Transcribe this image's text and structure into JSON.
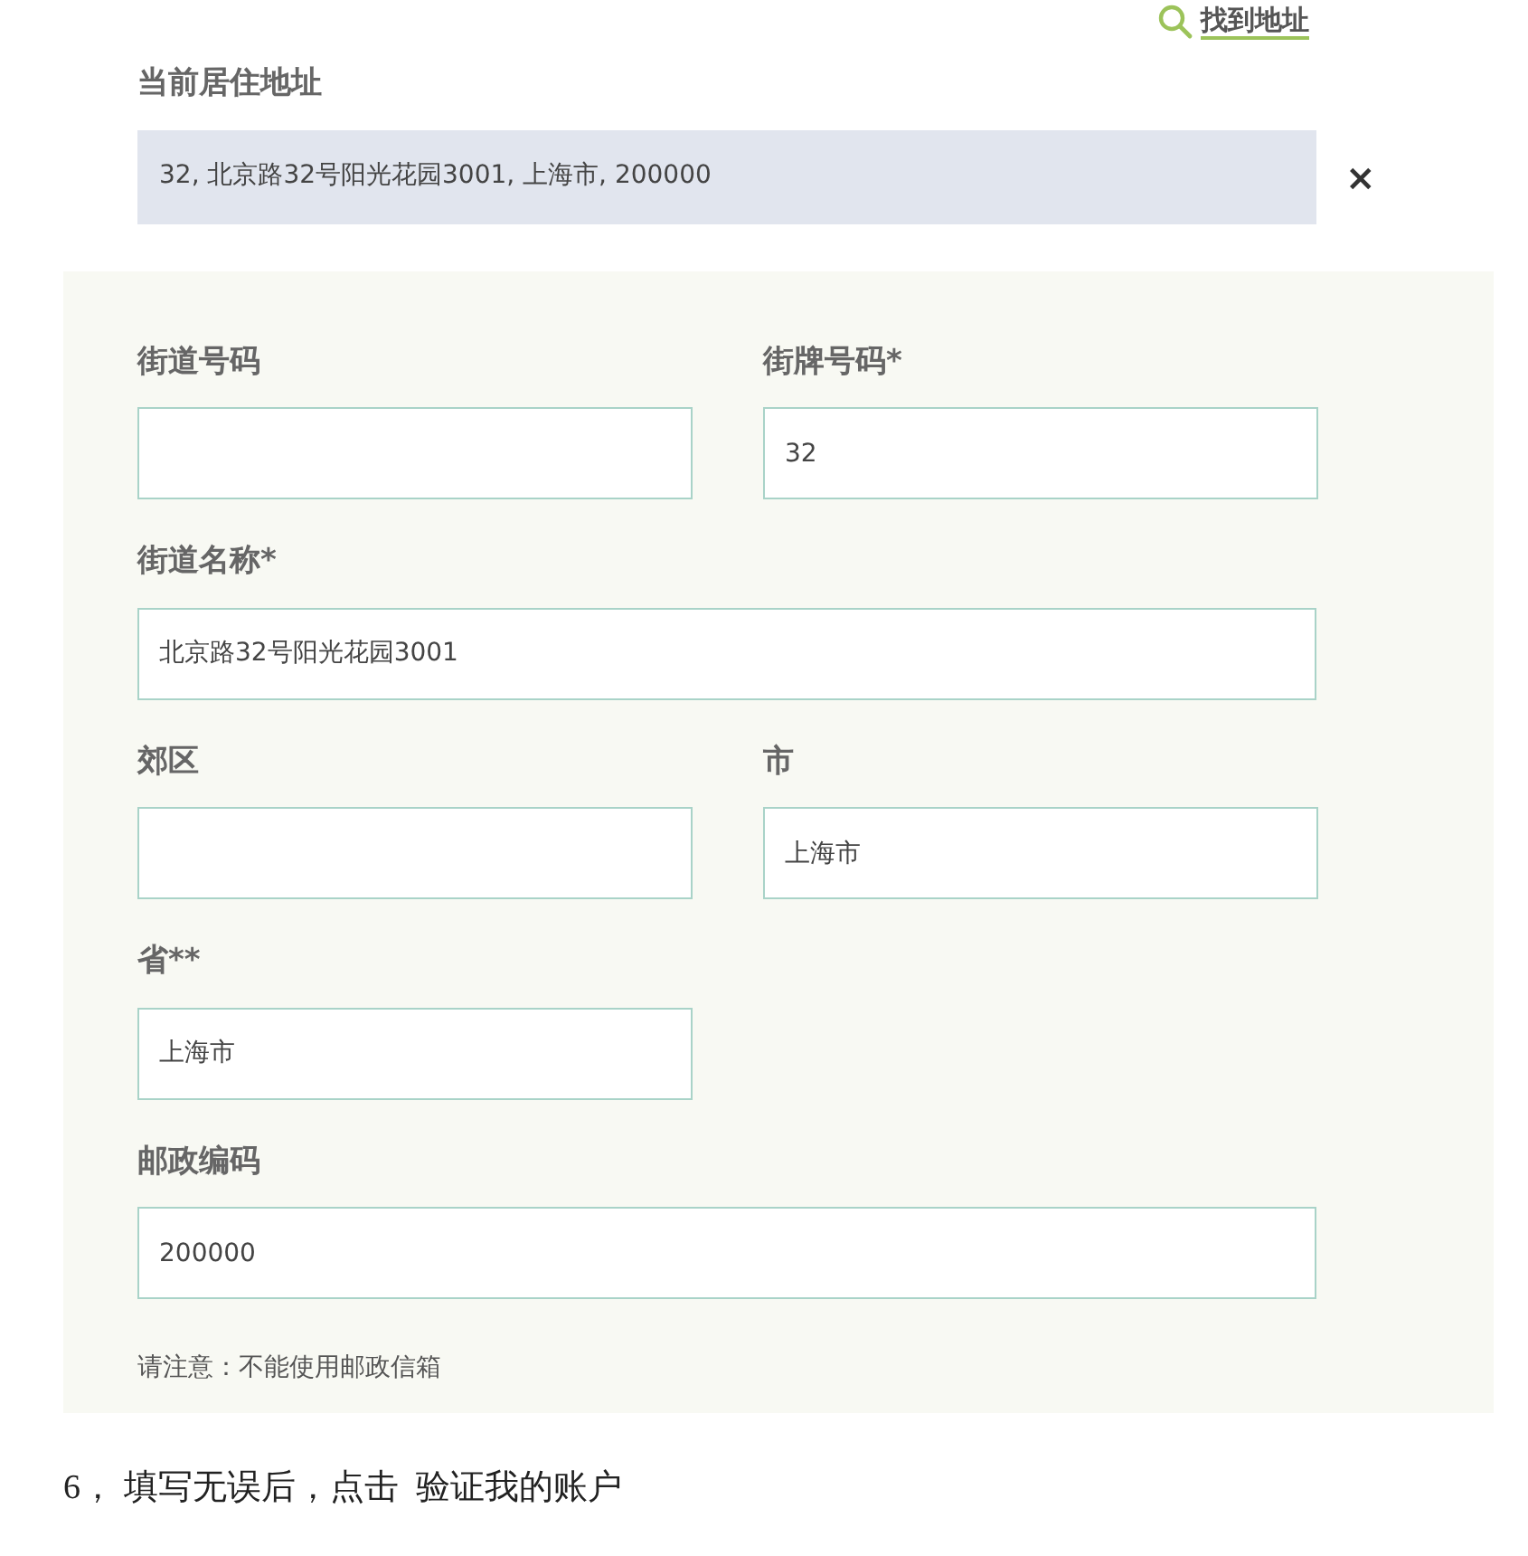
{
  "find_link": "找到地址",
  "current_address": {
    "label": "当前居住地址",
    "value": "32, 北京路32号阳光花园3001, 上海市, 200000",
    "clear": "×"
  },
  "rows": [
    [
      {
        "label": "街道号码",
        "kind": "half"
      },
      {
        "label": "街牌号码*",
        "value": "32",
        "kind": "half"
      }
    ],
    [
      {
        "label": "街道名称*",
        "value": "北京路32号阳光花园3001",
        "kind": "wide"
      }
    ],
    [
      {
        "label": "郊区",
        "kind": "half"
      },
      {
        "label": "市",
        "value": "上海市",
        "kind": "half"
      }
    ],
    [
      {
        "label": "省**",
        "value": "上海市",
        "kind": "half"
      }
    ],
    [
      {
        "label": "邮政编码",
        "value": "200000",
        "kind": "wide"
      }
    ]
  ],
  "note": "请注意：不能使用邮政信箱",
  "step": "6， 填写无误后，点击  验证我的账户"
}
